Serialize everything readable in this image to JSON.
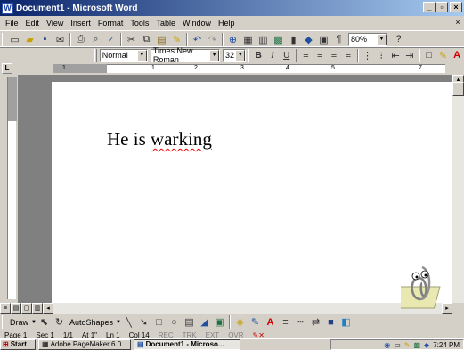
{
  "window": {
    "title": "Document1 - Microsoft Word",
    "app_icon": "W"
  },
  "menu": [
    "File",
    "Edit",
    "View",
    "Insert",
    "Format",
    "Tools",
    "Table",
    "Window",
    "Help"
  ],
  "standard_toolbar": {
    "zoom": "80%"
  },
  "formatting_toolbar": {
    "style": "Normal",
    "font": "Times New Roman",
    "size": "32",
    "bold": "B",
    "italic": "I",
    "underline": "U"
  },
  "ruler": {
    "ticks": [
      "1",
      "1",
      "2",
      "3",
      "4",
      "5",
      "7"
    ]
  },
  "document": {
    "text_prefix": "He is ",
    "text_misspelled": "warking"
  },
  "drawing_toolbar": {
    "draw_label": "Draw",
    "autoshapes_label": "AutoShapes"
  },
  "status": {
    "page": "Page 1",
    "sec": "Sec 1",
    "pages": "1/1",
    "at": "At 1\"",
    "ln": "Ln 1",
    "col": "Col 14",
    "rec": "REC",
    "trk": "TRK",
    "ext": "EXT",
    "ovr": "OVR"
  },
  "taskbar": {
    "start": "Start",
    "task1": "Adobe PageMaker 6.0",
    "task2": "Document1 - Microso...",
    "clock": "7:24 PM"
  }
}
